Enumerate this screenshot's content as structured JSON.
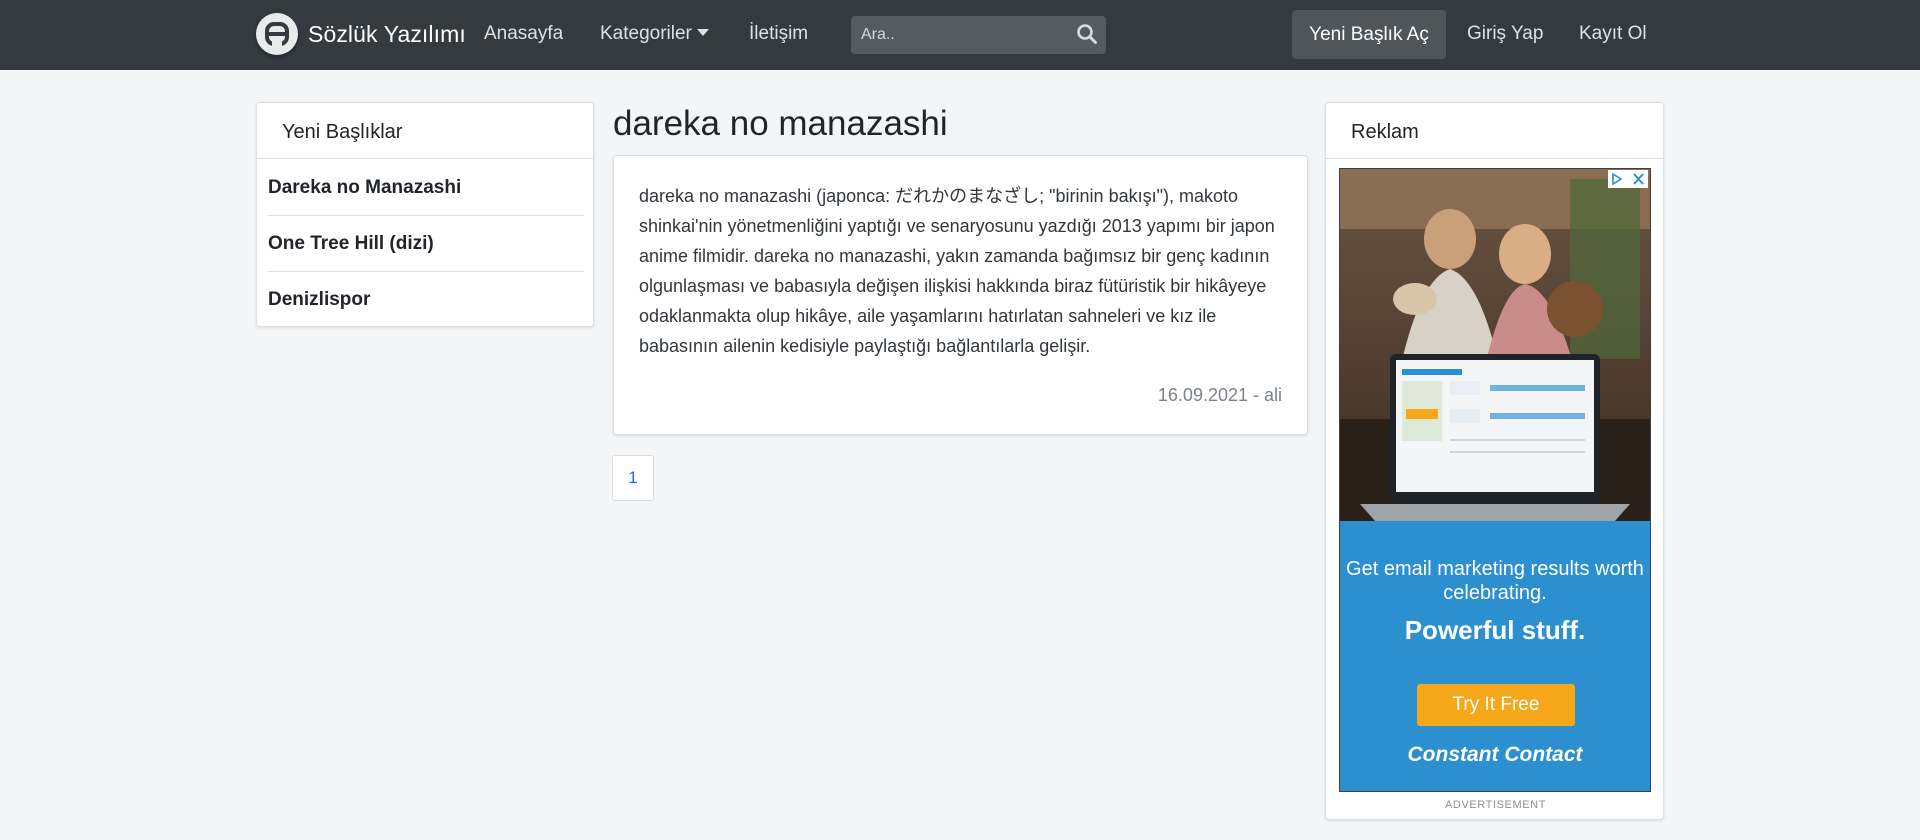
{
  "navbar": {
    "brand": "Sözlük Yazılımı",
    "links": [
      {
        "label": "Anasayfa"
      },
      {
        "label": "Kategoriler"
      },
      {
        "label": "İletişim"
      }
    ],
    "search_placeholder": "Ara..",
    "new_topic": "Yeni Başlık Aç",
    "login": "Giriş Yap",
    "register": "Kayıt Ol",
    "bg_color": "#343a40"
  },
  "sidebar": {
    "header": "Yeni Başlıklar",
    "items": [
      {
        "label": "Dareka no Manazashi"
      },
      {
        "label": "One Tree Hill (dizi)"
      },
      {
        "label": "Denizlispor"
      }
    ]
  },
  "topic": {
    "title": "dareka no manazashi",
    "entry_text": "dareka no manazashi (japonca: だれかのまなざし; \"birinin bakışı\"), makoto shinkai'nin yönetmenliğini yaptığı ve senaryosunu yazdığı 2013 yapımı bir japon anime filmidir. dareka no manazashi, yakın zamanda bağımsız bir genç kadının olgunlaşması ve babasıyla değişen ilişkisi hakkında biraz fütüristik bir hikâyeye odaklanmakta olup hikâye, aile yaşamlarını hatırlatan sahneleri ve kız ile babasının ailenin kedisiyle paylaştığı bağlantılarla gelişir.",
    "entry_meta": "16.09.2021 - ali"
  },
  "pagination": {
    "pages": [
      "1"
    ],
    "active_color": "#0d6efd"
  },
  "ad": {
    "header": "Reklam",
    "headline": "Get email marketing results worth celebrating.",
    "tagline": "Powerful stuff.",
    "cta": "Try It Free",
    "brand": "Constant Contact",
    "label": "ADVERTISEMENT",
    "blue": "#2b8fd0",
    "orange": "#f6a71a"
  }
}
